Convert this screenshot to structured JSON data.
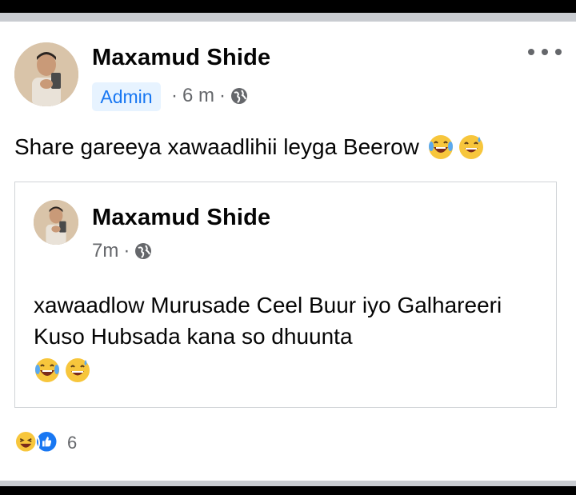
{
  "post": {
    "author": "Maxamud Shide",
    "badge": "Admin",
    "separator": "·",
    "time": "6 m",
    "privacy_icon": "globe-icon",
    "text": "Share gareeya xawaadlihii leyga Beerow",
    "emojis": [
      "laughing-tears-emoji",
      "grinning-sweat-emoji"
    ]
  },
  "shared_post": {
    "author": "Maxamud Shide",
    "separator": "·",
    "time": "7m",
    "privacy_icon": "globe-icon",
    "text": "xawaadlow Murusade Ceel Buur iyo Galhareeri Kuso Hubsada kana so dhuunta",
    "emojis": [
      "laughing-tears-emoji",
      "grinning-sweat-emoji"
    ]
  },
  "reactions": {
    "icons": [
      "haha-reaction-icon",
      "like-reaction-icon"
    ],
    "count": "6"
  },
  "colors": {
    "badge_bg": "#e7f3ff",
    "badge_text": "#1877f2",
    "meta_text": "#65676b",
    "like_blue": "#1877f2",
    "emoji_yellow": "#f7c63c"
  }
}
